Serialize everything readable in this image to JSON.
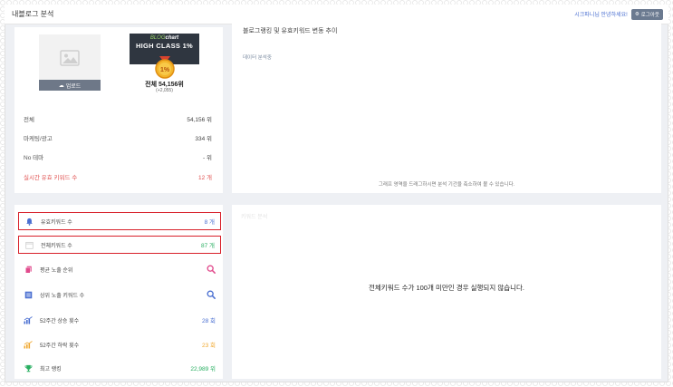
{
  "header": {
    "title": "내블로그 분석",
    "greeting": "시크파니님 안녕하세요!",
    "logout_label": "로그아웃"
  },
  "profile": {
    "upload_label": "업로드",
    "badge_brand_prefix": "BLOG",
    "badge_brand_suffix": "chart",
    "badge_class": "HIGH CLASS 1%",
    "medal_text": "1%",
    "rank_total": "전체 54,156위",
    "rank_change": "(+2,055)",
    "rows": [
      {
        "label": "전체",
        "value": "54,156 위"
      },
      {
        "label": "마케팅/광고",
        "value": "334 위"
      },
      {
        "label": "No 테마",
        "value": "- 위"
      },
      {
        "label": "실시간 유효 키워드 수",
        "value": "12 개"
      }
    ]
  },
  "chart_panel": {
    "title": "블로그랭킹 및 유효키워드 변동 추이",
    "status": "데이터 분석중",
    "hint": "그래프 영역을 드래그하시면 분석 기간을 축소하여 볼 수 있습니다."
  },
  "stats": [
    {
      "icon": "bell-icon",
      "label": "유효키워드 수",
      "value": "8 개",
      "color": "#4a6fd1"
    },
    {
      "icon": "calendar-icon",
      "label": "전체키워드 수",
      "value": "87 개",
      "color": "#27ae60"
    },
    {
      "icon": "copy-icon",
      "label": "평균 노출 순위",
      "value": "",
      "color": "#e14a8c"
    },
    {
      "icon": "list-icon",
      "label": "상위 노출 키워드 수",
      "value": "",
      "color": "#4a6fd1"
    },
    {
      "icon": "chart-up-icon",
      "label": "52주간 상승 횟수",
      "value": "28 회",
      "color": "#4a6fd1"
    },
    {
      "icon": "chart-down-icon",
      "label": "52주간 하락 횟수",
      "value": "23 회",
      "color": "#f0a830"
    },
    {
      "icon": "trophy-icon",
      "label": "최고 랭킹",
      "value": "22,989 위",
      "color": "#27ae60"
    }
  ],
  "bottom_panel": {
    "faint_title": "키워드 분석",
    "message": "전체키워드 수가 100개 미만인 경우 실행되지 않습니다."
  },
  "colors": {
    "accent": "#4a6fd1",
    "highlight_border": "#d8202a",
    "alert": "#e0504f"
  }
}
